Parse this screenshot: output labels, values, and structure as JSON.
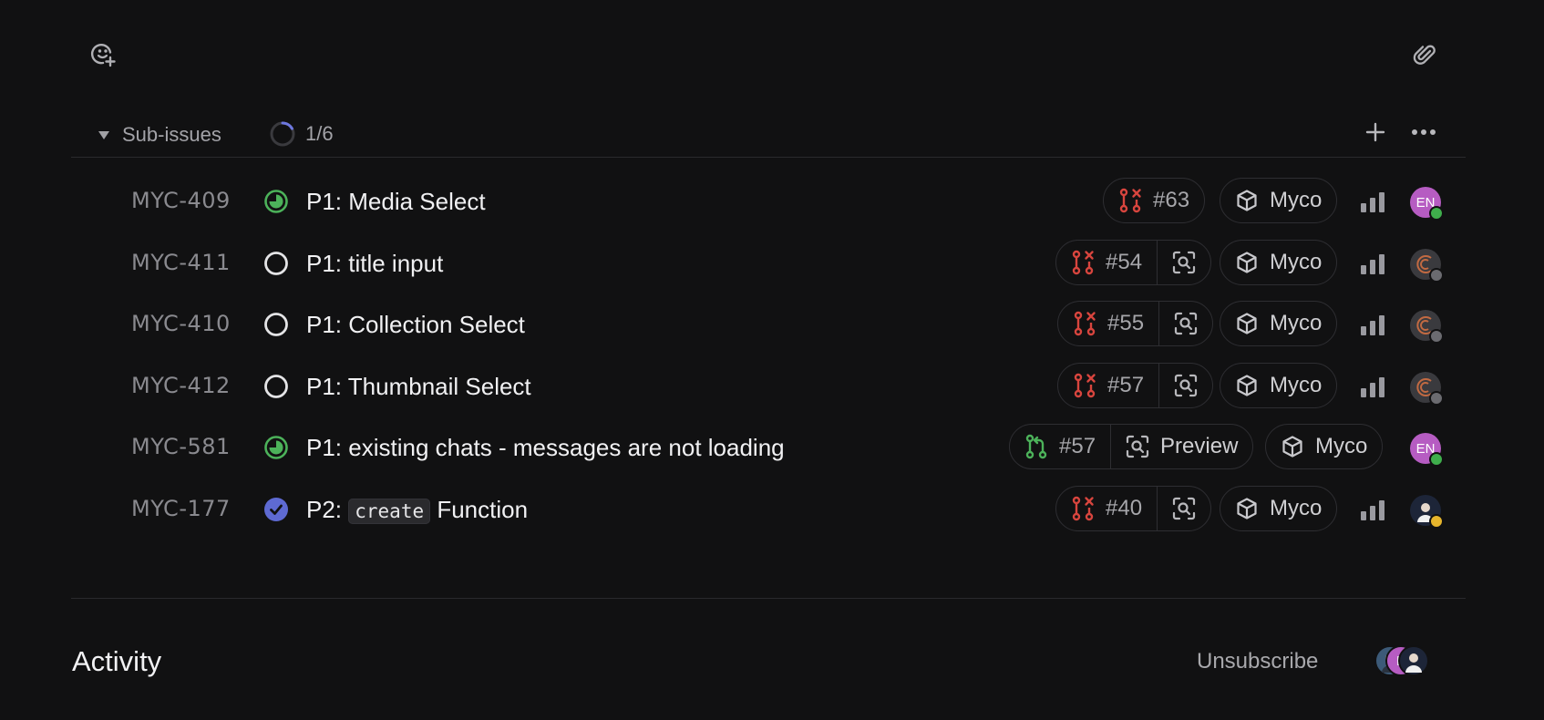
{
  "toolbar": {
    "emoji_icon": "add-reaction-icon",
    "attach_icon": "paperclip-icon"
  },
  "subissues": {
    "title": "Sub-issues",
    "progress_text": "1/6",
    "progress_fraction": 0.1667,
    "add_icon": "plus-icon",
    "more_icon": "ellipsis-icon"
  },
  "rows": [
    {
      "id": "MYC-409",
      "status": "in-progress",
      "prefix": "P1: ",
      "code": "",
      "suffix": "Media Select",
      "pr_number": "#63",
      "pr_state": "closed",
      "review": false,
      "preview_label": "",
      "project": "Myco",
      "avatar": {
        "type": "initials",
        "text": "EN",
        "color": "#b65cc2",
        "presence": "#3fae4c"
      }
    },
    {
      "id": "MYC-411",
      "status": "todo",
      "prefix": "P1: ",
      "code": "",
      "suffix": "title input",
      "pr_number": "#54",
      "pr_state": "closed",
      "review": true,
      "preview_label": "",
      "project": "Myco",
      "avatar": {
        "type": "logo",
        "text": "",
        "color": "#3a3a3e",
        "presence": "#6b6b70"
      }
    },
    {
      "id": "MYC-410",
      "status": "todo",
      "prefix": "P1: ",
      "code": "",
      "suffix": "Collection Select",
      "pr_number": "#55",
      "pr_state": "closed",
      "review": true,
      "preview_label": "",
      "project": "Myco",
      "avatar": {
        "type": "logo",
        "text": "",
        "color": "#3a3a3e",
        "presence": "#6b6b70"
      }
    },
    {
      "id": "MYC-412",
      "status": "todo",
      "prefix": "P1: ",
      "code": "",
      "suffix": "Thumbnail Select",
      "pr_number": "#57",
      "pr_state": "closed",
      "review": true,
      "preview_label": "",
      "project": "Myco",
      "avatar": {
        "type": "logo",
        "text": "",
        "color": "#3a3a3e",
        "presence": "#6b6b70"
      }
    },
    {
      "id": "MYC-581",
      "status": "in-progress",
      "prefix": "P1: ",
      "code": "",
      "suffix": "existing chats - messages are not loading",
      "pr_number": "#57",
      "pr_state": "open",
      "review": true,
      "preview_label": "Preview",
      "project": "Myco",
      "avatar": {
        "type": "initials",
        "text": "EN",
        "color": "#b65cc2",
        "presence": "#3fae4c"
      }
    },
    {
      "id": "MYC-177",
      "status": "done",
      "prefix": "P2: ",
      "code": "create",
      "suffix": " Function",
      "pr_number": "#40",
      "pr_state": "closed",
      "review": true,
      "preview_label": "",
      "project": "Myco",
      "avatar": {
        "type": "photo",
        "text": "",
        "color": "#1d2538",
        "presence": "#e6b52c"
      }
    }
  ],
  "activity": {
    "title": "Activity",
    "unsubscribe": "Unsubscribe",
    "subscriber_initial": "E"
  },
  "colors": {
    "background": "#111112",
    "in_progress": "#4cb25a",
    "done": "#5e6ad2",
    "pr_closed": "#d8453e",
    "pr_open": "#4cb25a"
  }
}
